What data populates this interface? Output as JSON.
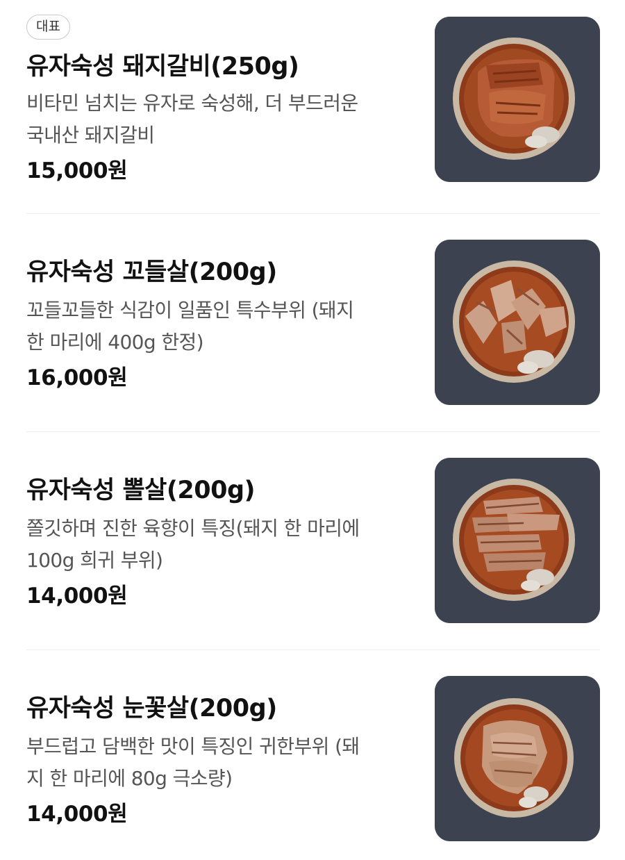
{
  "menu": {
    "items": [
      {
        "badge": "대표",
        "name": "유자숙성 돼지갈비(250g)",
        "desc_line1": "비타민 넘치는 유자로 숙성해, 더 부드러운",
        "desc_line2": "국내산 돼지갈비",
        "price": "15,000원",
        "image": "marinated-pork-ribs-photo"
      },
      {
        "name": "유자숙성 꼬들살(200g)",
        "desc_line1": "꼬들꼬들한 식감이 일품인 특수부위 (돼지",
        "desc_line2": "한 마리에 400g 한정)",
        "price": "16,000원",
        "image": "pork-jowl-chunks-photo"
      },
      {
        "name": "유자숙성 뽈살(200g)",
        "desc_line1": "쫄깃하며 진한 육향이 특징(돼지 한 마리에",
        "desc_line2": "100g 희귀 부위)",
        "price": "14,000원",
        "image": "pork-cheek-strips-photo"
      },
      {
        "name": "유자숙성 눈꽃살(200g)",
        "desc_line1": "부드럽고 담백한 맛이 특징인 귀한부위 (돼",
        "desc_line2": "지 한 마리에 80g 극소량)",
        "price": "14,000원",
        "image": "pork-snowflake-cut-photo"
      }
    ]
  }
}
